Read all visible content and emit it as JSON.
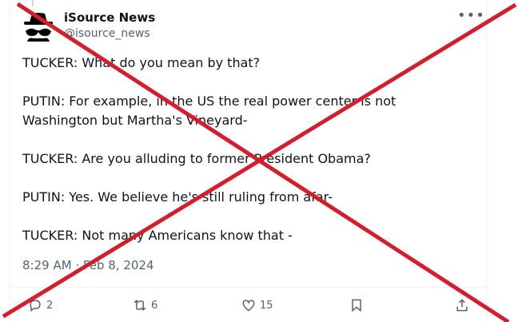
{
  "account": {
    "name": "iSource News",
    "handle": "@isource_news"
  },
  "tweet": {
    "lines": [
      "TUCKER: What do you mean by that?",
      "PUTIN: For example, in the US the real power center is not Washington but Martha's Vineyard-",
      "TUCKER: Are you alluding to former President Obama?",
      "PUTIN: Yes. We believe he's still ruling from afar-",
      "TUCKER: Not many Americans know that -"
    ],
    "timestamp": "8:29 AM · Feb 8, 2024"
  },
  "actions": {
    "replies": "2",
    "reposts": "6",
    "likes": "15"
  },
  "icons": [
    "spy-avatar-icon",
    "more-icon",
    "reply-icon",
    "repost-icon",
    "like-icon",
    "bookmark-icon",
    "share-icon"
  ],
  "colors": {
    "cross": "#d0202e",
    "muted": "#536471",
    "text": "#0f1419"
  }
}
